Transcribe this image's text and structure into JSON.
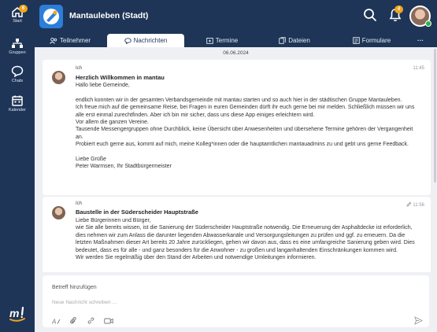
{
  "rail": {
    "start_label": "Start",
    "start_badge": "6",
    "groups_label": "Gruppen",
    "chats_label": "Chats",
    "calendar_label": "Kalender"
  },
  "header": {
    "title": "Mantauleben (Stadt)",
    "notification_badge": "4"
  },
  "tabs": [
    {
      "label": "Teilnehmer"
    },
    {
      "label": "Nachrichten"
    },
    {
      "label": "Termine"
    },
    {
      "label": "Dateien"
    },
    {
      "label": "Formulare"
    },
    {
      "label": "···"
    }
  ],
  "content": {
    "date": "06.06.2024",
    "messages": [
      {
        "author": "Ich",
        "time": "11:45",
        "title": "Herzlich Willkommen in mantau",
        "lines": [
          "Hallo liebe Gemeinde,",
          "",
          "endlich konnten wir in der gesamten Verbandsgemeinde mit mantau starten und so auch hier in der städtischen Gruppe Mantauleben.",
          "Ich freue mich auf die gemeinsame Reise, bei Fragen in euren Gemeinden dürft ihr euch gerne bei mir melden. Schließlich müssen wir uns alle erst einmal zurechtfinden. Aber ich bin mir sicher, dass uns diese App einiges erleichtern wird.",
          "Vor allem die ganzen Vereine.",
          "Tausende Messengergruppen ohne Durchblick, keine Übersicht über Anwesenheiten und übersehene Termine gehören der Vergangenheit an.",
          "Probiert euch gerne aus, kommt auf mich, meine Kolleg*innen oder die hauptamtlichen mantauadmins zu und gebt uns gerne Feedback.",
          "",
          "Liebe Grüße",
          "Peter Warmsen, Ihr Stadtbürgermeister"
        ]
      },
      {
        "author": "Ich",
        "time": "11:56",
        "title": "Baustelle in der Süderscheider Hauptstraße",
        "lines": [
          "Liebe Bürgerinnen und Bürger,",
          "wie Sie alle bereits wissen, ist die Sanierung der Süderscheider Hauptstraße notwendig. Die Erneuerung der Asphaltdecke ist erforderlich, dies nehmen wir zum Anlass die darunter liegenden Abwasserkanäle und Versorgungsleitungen zu prüfen und ggf. zu erneuern. Da die letzten Maßnahmen dieser Art bereits 20 Jahre zurückliegen, gehen wir davon aus, dass es eine umfangreiche Sanierung geben wird. Dies bedeutet, dass es für alle - und ganz besonders für die Anwohner - zu großen und langanhaltenden Einschränkungen kommen wird.",
          "Wir werden Sie regelmäßig über den Stand der Arbeiten und notwendige Umleitungen informieren."
        ]
      }
    ]
  },
  "composer": {
    "subject_placeholder": "Betreff hinzufügen",
    "message_placeholder": "Neue Nachricht schreiben ..."
  }
}
